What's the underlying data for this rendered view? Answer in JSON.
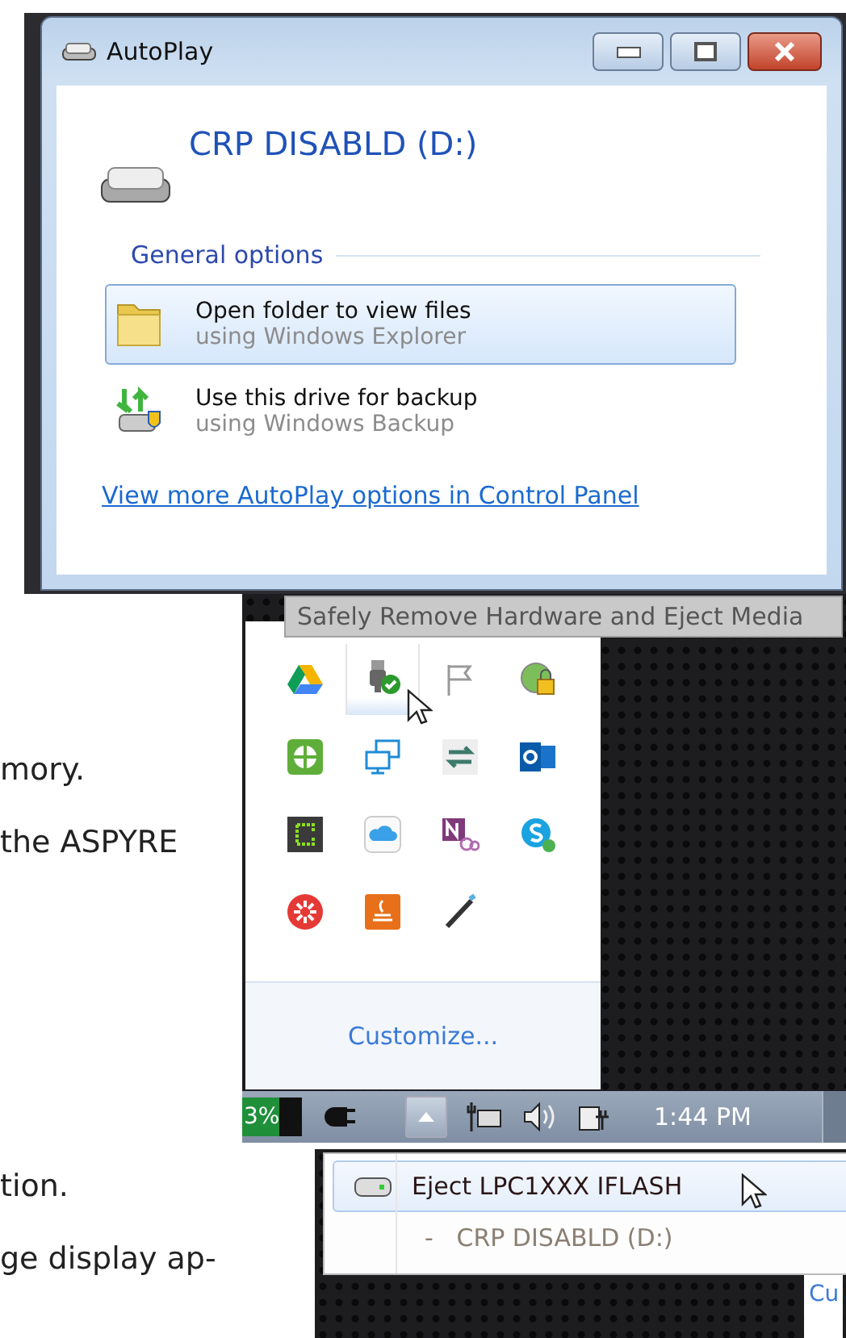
{
  "autoplay_window": {
    "title": "AutoPlay",
    "drive_label": "CRP DISABLD (D:)",
    "section": "General options",
    "options": [
      {
        "kind": "folder",
        "title": "Open folder to view files",
        "subtitle": "using Windows Explorer",
        "selected": true
      },
      {
        "kind": "backup",
        "title": "Use this drive for backup",
        "subtitle": "using Windows Backup",
        "selected": false
      }
    ],
    "link": "View more AutoPlay options in Control Panel"
  },
  "document_text": {
    "upper": [
      "mory.",
      "the ASPYRE"
    ],
    "lower": [
      "tion.",
      "ge display ap-"
    ]
  },
  "tray_popup": {
    "tooltip": "Safely Remove Hardware and Eject Media",
    "icons": [
      {
        "kind": "drive",
        "hovered": false
      },
      {
        "kind": "usb",
        "hovered": true
      },
      {
        "kind": "flag",
        "hovered": false
      },
      {
        "kind": "globe-lock",
        "hovered": false
      },
      {
        "kind": "shield",
        "hovered": false
      },
      {
        "kind": "monitors",
        "hovered": false
      },
      {
        "kind": "arrows",
        "hovered": false
      },
      {
        "kind": "mail",
        "hovered": false
      },
      {
        "kind": "terminal",
        "hovered": false
      },
      {
        "kind": "cloud",
        "hovered": false
      },
      {
        "kind": "notebook",
        "hovered": false
      },
      {
        "kind": "chat",
        "hovered": false
      },
      {
        "kind": "red-circle",
        "hovered": false
      },
      {
        "kind": "cup",
        "hovered": false
      },
      {
        "kind": "pen",
        "hovered": false
      }
    ],
    "customize": "Customize..."
  },
  "taskbar": {
    "battery_text": "3%",
    "clock": "1:44 PM"
  },
  "eject_menu": {
    "items": [
      {
        "kind": "device",
        "text": "Eject LPC1XXX IFLASH",
        "selected": true
      },
      {
        "kind": "volume",
        "text": "-   CRP DISABLD (D:)",
        "selected": false
      }
    ],
    "partial_link": "Cu"
  }
}
